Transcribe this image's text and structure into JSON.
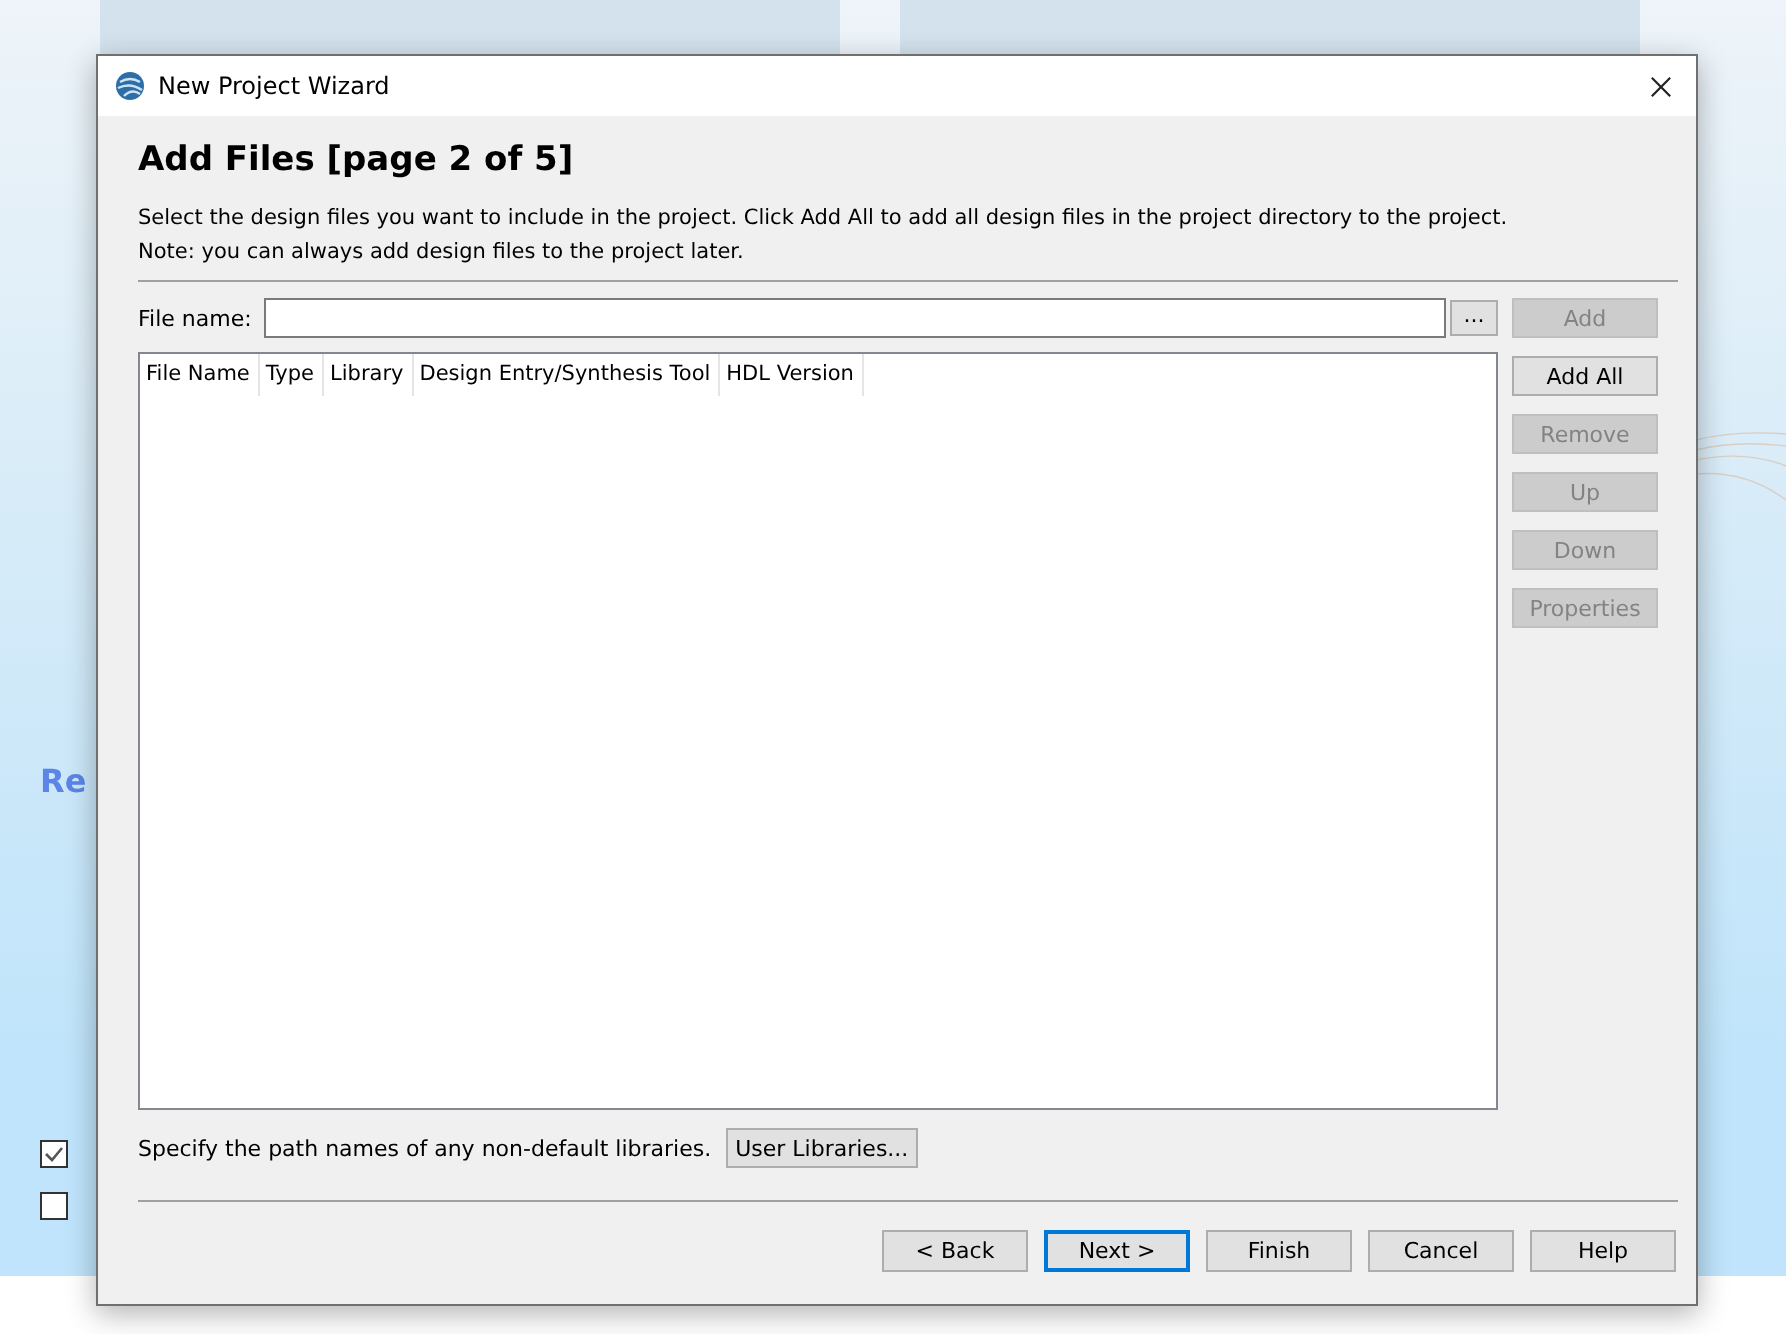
{
  "background": {
    "heading": "Re",
    "checkboxes": [
      {
        "checked": true
      },
      {
        "checked": false
      }
    ]
  },
  "window": {
    "title": "New Project Wizard"
  },
  "page": {
    "heading": "Add Files [page 2 of 5]",
    "description": "Select the design files you want to include in the project. Click Add All to add all design files in the project directory to the project.",
    "note": "Note: you can always add design files to the project later."
  },
  "file_name": {
    "label": "File name:",
    "browse": "..."
  },
  "table": {
    "columns": [
      "File Name",
      "Type",
      "Library",
      "Design Entry/Synthesis Tool",
      "HDL Version"
    ]
  },
  "side_buttons": [
    {
      "label": "Add",
      "disabled": true
    },
    {
      "label": "Add All",
      "disabled": false
    },
    {
      "label": "Remove",
      "disabled": true
    },
    {
      "label": "Up",
      "disabled": true
    },
    {
      "label": "Down",
      "disabled": true
    },
    {
      "label": "Properties",
      "disabled": true
    }
  ],
  "libraries": {
    "text": "Specify the path names of any non-default libraries.",
    "button": "User Libraries..."
  },
  "footer_buttons": [
    {
      "label": "< Back",
      "default": false
    },
    {
      "label": "Next >",
      "default": true
    },
    {
      "label": "Finish",
      "default": false
    },
    {
      "label": "Cancel",
      "default": false
    },
    {
      "label": "Help",
      "default": false
    }
  ]
}
